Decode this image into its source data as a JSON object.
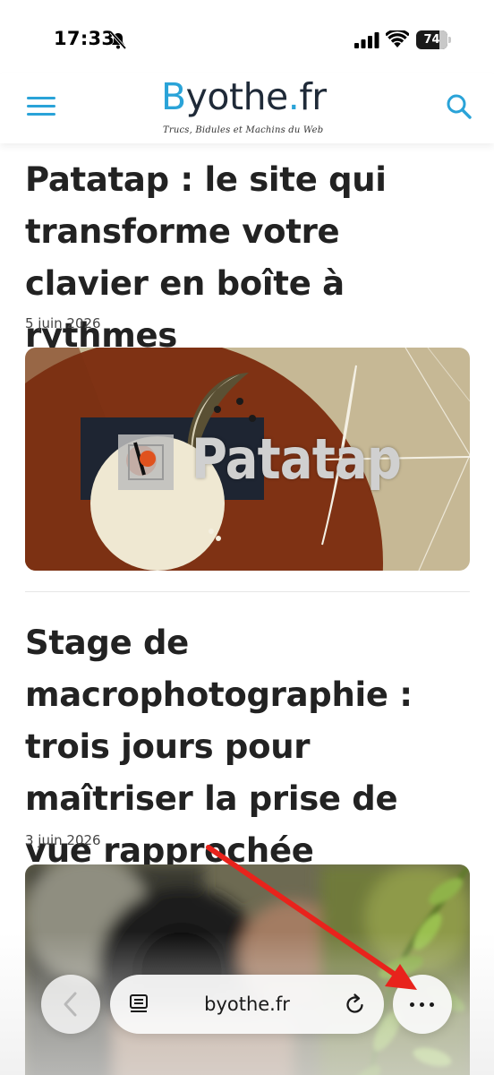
{
  "status_bar": {
    "time": "17:33",
    "battery_level": "74",
    "battery_fraction": 0.74
  },
  "header": {
    "logo_part1": "B",
    "logo_part2": "yothe",
    "logo_dot": ".",
    "logo_part3": "fr",
    "tagline": "Trucs, Bidules et Machins du Web",
    "accent_color": "#2aa3d8",
    "menu_icon": "hamburger-icon",
    "search_icon": "search-icon"
  },
  "articles": [
    {
      "title": "Patatap : le site qui transforme votre clavier en boîte à rythmes",
      "date": "5 juin 2026",
      "image_text": "Patatap"
    },
    {
      "title": "Stage de macrophotographie : trois jours pour maîtriser la prise de vue rapprochée",
      "date": "3 juin 2026"
    }
  ],
  "browser_bar": {
    "url": "byothe.fr",
    "back_icon": "chevron-left-icon",
    "reader_icon": "page-menu-icon",
    "reload_icon": "reload-icon",
    "more_icon": "more-dots-icon"
  },
  "annotation": {
    "arrow_color": "#e8231c"
  }
}
